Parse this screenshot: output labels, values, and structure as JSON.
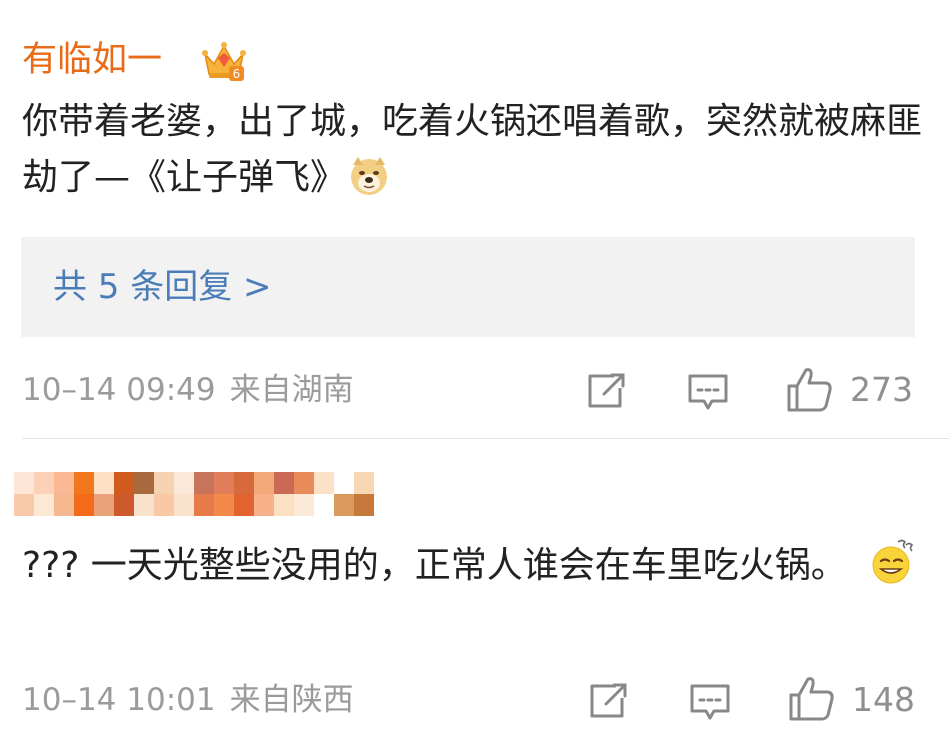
{
  "comments": [
    {
      "username": "有临如一",
      "badge_icon": "crown-badge-level-6",
      "badge_level": "6",
      "text": "你带着老婆，出了城，吃着火锅还唱着歌，突然就被麻匪劫了—《让子弹飞》",
      "emoji_icon": "doge-emoji",
      "replies_label": "共 5 条回复 >",
      "timestamp": "10–14 09:49",
      "location": "来自湖南",
      "like_count": "273"
    },
    {
      "username_pixelated": true,
      "text": "??? 一天光整些没用的，正常人谁会在车里吃火锅。",
      "emoji_icon": "sweat-smile-emoji",
      "timestamp": "10–14 10:01",
      "location": "来自陕西",
      "like_count": "148"
    }
  ],
  "icons": {
    "share": "share-icon",
    "comment": "comment-icon",
    "like": "thumbs-up-icon"
  },
  "colors": {
    "username": "#e86c17",
    "link": "#4a7db8",
    "meta": "#9b9b9b",
    "reply_bg": "#f2f2f2"
  }
}
